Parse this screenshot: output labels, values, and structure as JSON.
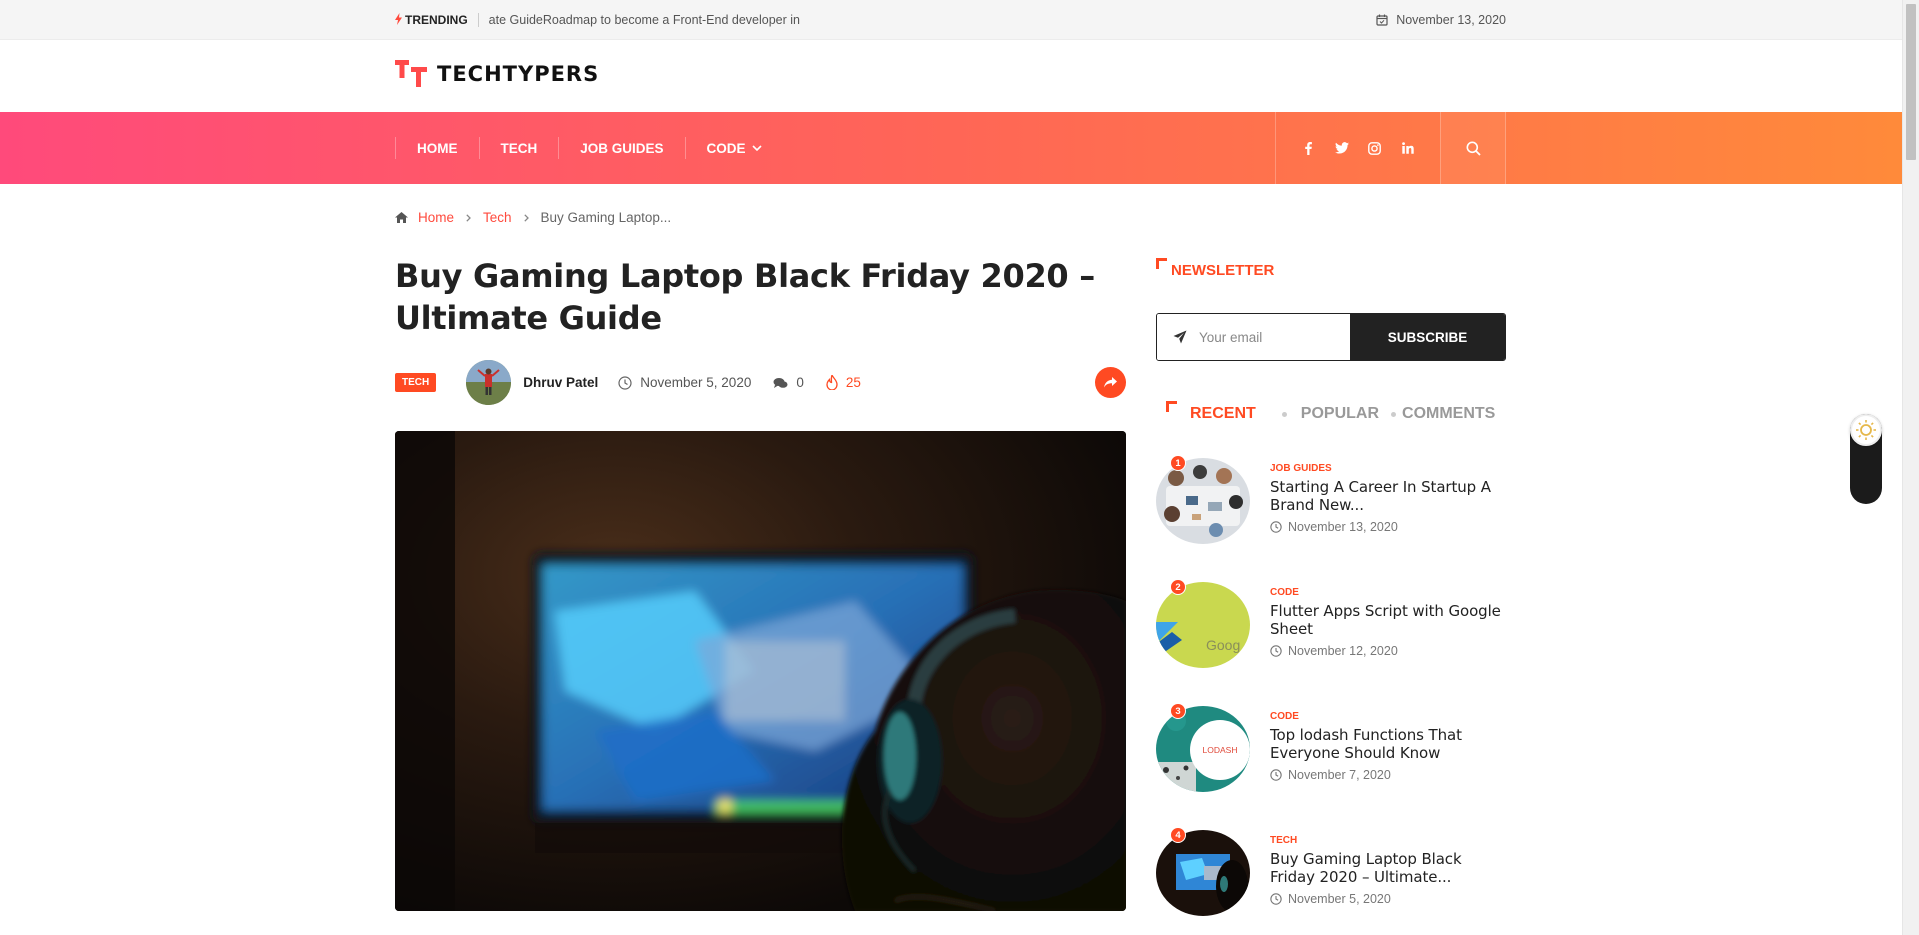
{
  "topbar": {
    "trending_label": "TRENDING",
    "trending_text": "ate GuideRoadmap to become a Front-End developer in",
    "date": "November 13, 2020"
  },
  "header": {
    "logo_text": "TECHTYPERS"
  },
  "nav": {
    "items": [
      {
        "label": "HOME"
      },
      {
        "label": "TECH"
      },
      {
        "label": "JOB GUIDES"
      },
      {
        "label": "CODE",
        "has_dropdown": true
      }
    ],
    "socials": [
      "facebook-icon",
      "twitter-icon",
      "instagram-icon",
      "linkedin-icon"
    ],
    "gradient": [
      "#ff4a7b",
      "#ff8a3a"
    ]
  },
  "breadcrumb": {
    "home": "Home",
    "section": "Tech",
    "current": "Buy Gaming Laptop..."
  },
  "article": {
    "title": "Buy Gaming Laptop Black Friday 2020 – Ultimate Guide",
    "category": "TECH",
    "author": "Dhruv Patel",
    "date": "November 5, 2020",
    "comments": "0",
    "views": "25"
  },
  "sidebar": {
    "newsletter_heading": "NEWSLETTER",
    "email_placeholder": "Your email",
    "subscribe_label": "SUBSCRIBE",
    "tabs": [
      {
        "label": "RECENT",
        "active": true
      },
      {
        "label": "POPULAR",
        "active": false
      },
      {
        "label": "COMMENTS",
        "active": false
      }
    ],
    "posts": [
      {
        "rank": "1",
        "category": "JOB GUIDES",
        "title": "Starting A Career In Startup A Brand New...",
        "date": "November 13, 2020"
      },
      {
        "rank": "2",
        "category": "CODE",
        "title": "Flutter Apps Script with Google Sheet",
        "date": "November 12, 2020",
        "thumb_text": "Goog"
      },
      {
        "rank": "3",
        "category": "CODE",
        "title": "Top lodash Functions That Everyone Should Know",
        "date": "November 7, 2020",
        "thumb_text": "LODASH"
      },
      {
        "rank": "4",
        "category": "TECH",
        "title": "Buy Gaming Laptop Black Friday 2020 – Ultimate...",
        "date": "November 5, 2020"
      }
    ]
  },
  "colors": {
    "accent": "#ff4a22",
    "dark": "#222222"
  }
}
